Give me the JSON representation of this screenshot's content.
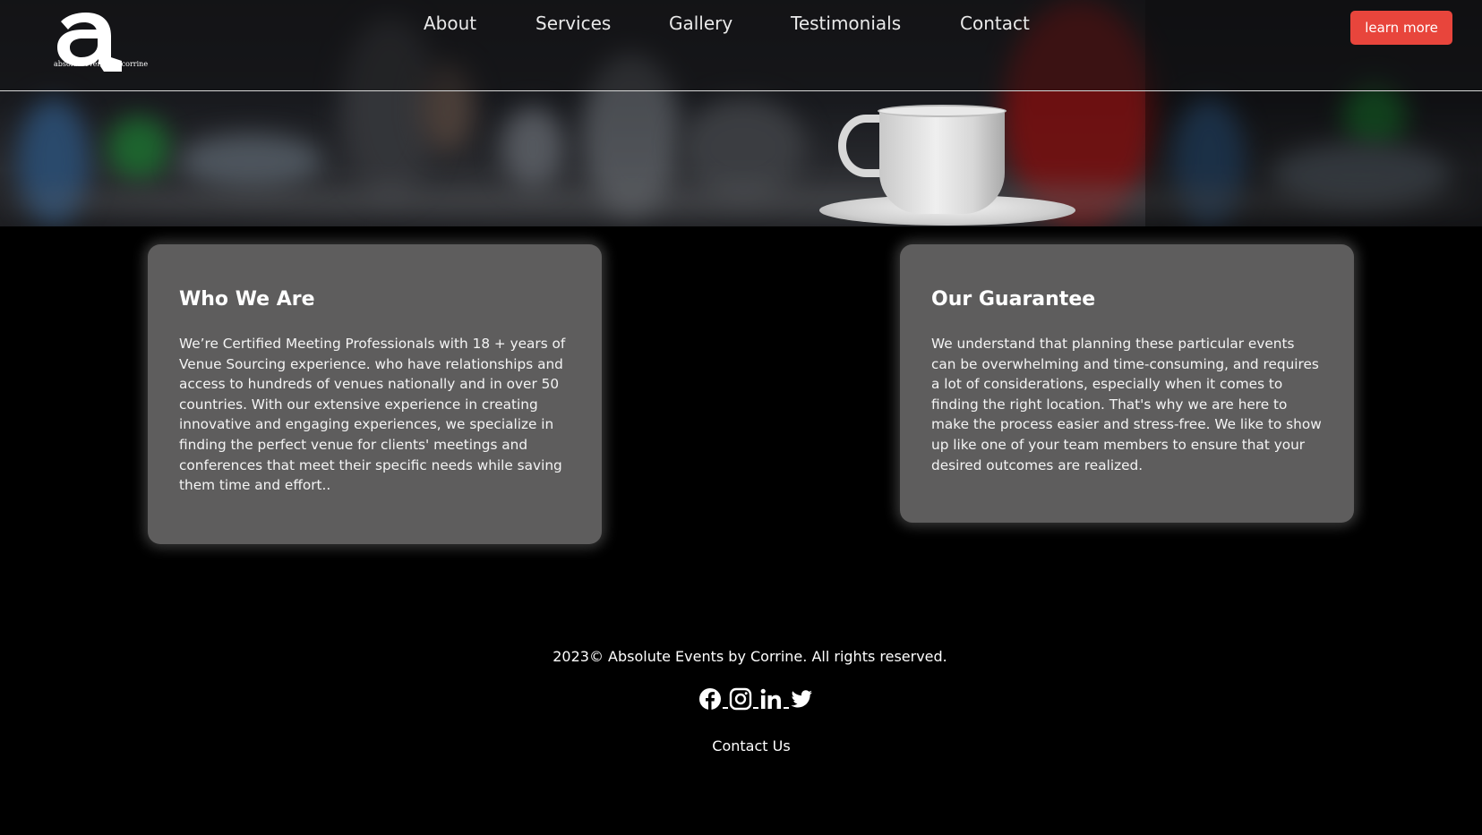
{
  "brand": {
    "logo_letter": "a",
    "logo_text": "absoluteevents by corrine"
  },
  "nav": {
    "items": [
      {
        "label": "About"
      },
      {
        "label": "Services"
      },
      {
        "label": "Gallery"
      },
      {
        "label": "Testimonials"
      },
      {
        "label": "Contact"
      }
    ],
    "cta_label": "learn more"
  },
  "colors": {
    "accent": "#e8453c",
    "card_bg": "#5e5d5d",
    "page_bg": "#000000"
  },
  "cards": [
    {
      "title": "Who We Are",
      "body": "We’re Certified Meeting Professionals with 18 + years of Venue Sourcing experience. who have relationships and access to hundreds of venues nationally and in over 50 countries. With our extensive experience in creating innovative and engaging experiences, we specialize in finding the perfect venue for clients' meetings and conferences that meet their specific needs while saving them time and effort.."
    },
    {
      "title": "Our Guarantee",
      "body": "We understand that planning these particular events can be overwhelming and time-consuming, and requires a lot of considerations, especially when it comes to finding the right location. That's why we are here to make the process easier and stress-free. We like to show up like one of your team members to ensure that your desired outcomes are realized."
    }
  ],
  "footer": {
    "copyright": "2023© Absolute Events by Corrine. All rights reserved.",
    "social_icons": [
      "facebook-icon",
      "instagram-icon",
      "linkedin-icon",
      "twitter-icon"
    ],
    "contact_link": "Contact Us"
  }
}
